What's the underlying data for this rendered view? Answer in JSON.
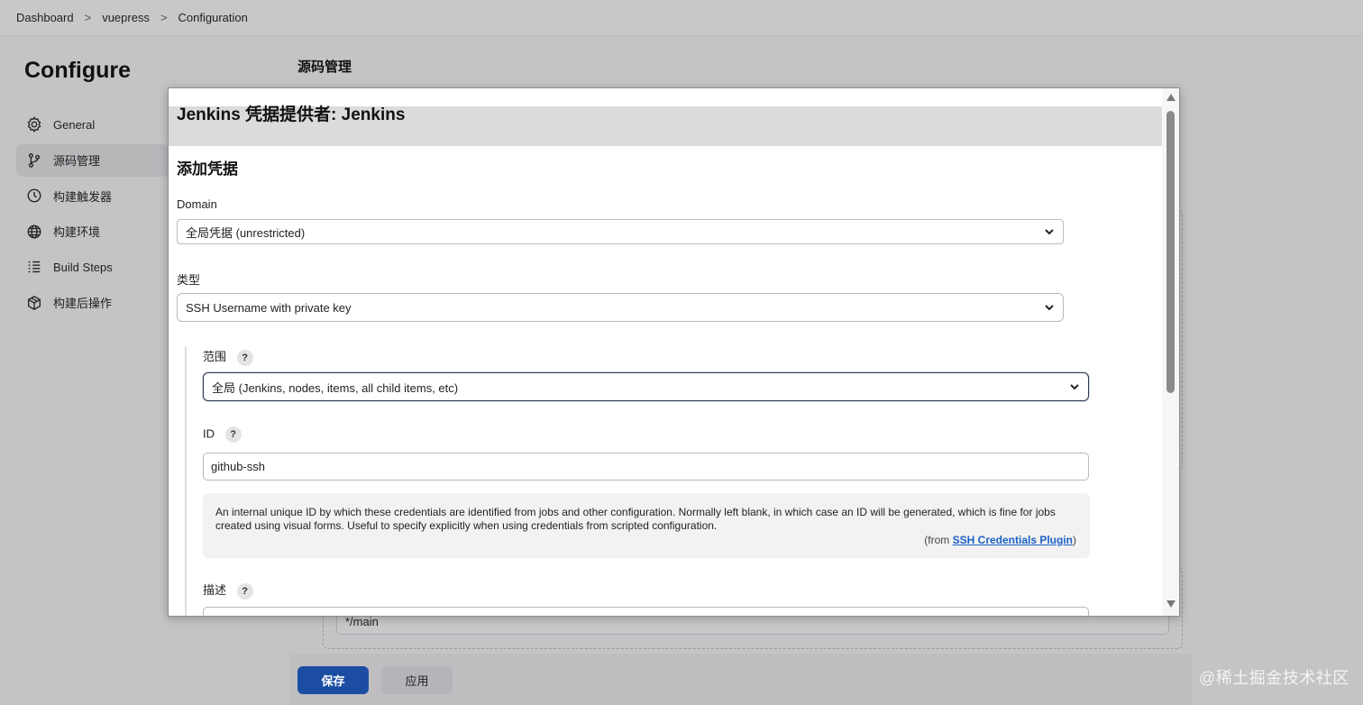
{
  "breadcrumb": [
    "Dashboard",
    "vuepress",
    "Configuration"
  ],
  "breadcrumb_separator": ">",
  "page": {
    "title": "Configure",
    "section_title": "源码管理"
  },
  "sidebar": {
    "items": [
      {
        "label": "General",
        "icon": "gear-icon",
        "active": false
      },
      {
        "label": "源码管理",
        "icon": "branch-icon",
        "active": true
      },
      {
        "label": "构建触发器",
        "icon": "timer-icon",
        "active": false
      },
      {
        "label": "构建环境",
        "icon": "globe-icon",
        "active": false
      },
      {
        "label": "Build Steps",
        "icon": "list-icon",
        "active": false
      },
      {
        "label": "构建后操作",
        "icon": "package-icon",
        "active": false
      }
    ]
  },
  "background": {
    "branch_value": "*/main",
    "save_label": "保存",
    "apply_label": "应用",
    "watermark": "@稀土掘金技术社区"
  },
  "modal": {
    "title": "Jenkins 凭据提供者: Jenkins",
    "heading": "添加凭据",
    "domain": {
      "label": "Domain",
      "value": "全局凭据 (unrestricted)"
    },
    "kind": {
      "label": "类型",
      "value": "SSH Username with private key"
    },
    "scope": {
      "label": "范围",
      "value": "全局 (Jenkins, nodes, items, all child items, etc)",
      "help": "?"
    },
    "id": {
      "label": "ID",
      "value": "github-ssh",
      "help": "?"
    },
    "id_help": {
      "text": "An internal unique ID by which these credentials are identified from jobs and other configuration. Normally left blank, in which case an ID will be generated, which is fine for jobs created using visual forms. Useful to specify explicitly when using credentials from scripted configuration.",
      "from_prefix": "(from ",
      "from_link": "SSH Credentials Plugin",
      "from_suffix": ")"
    },
    "description": {
      "label": "描述",
      "help": "?",
      "value": ""
    }
  },
  "colors": {
    "save_button": "#1b4ea3",
    "link": "#1b62c4",
    "modal_header": "#dadbdd"
  }
}
